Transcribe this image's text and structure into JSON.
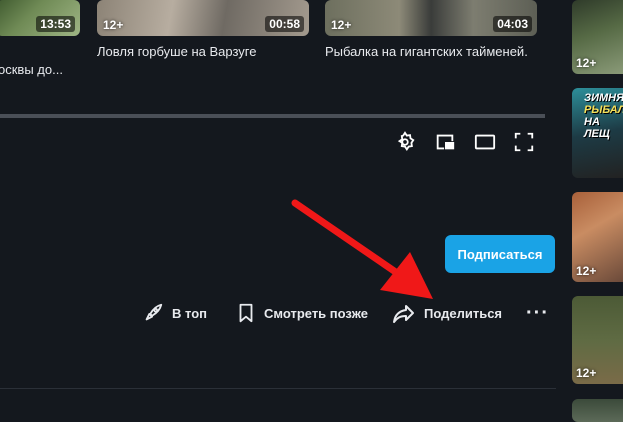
{
  "top_videos": [
    {
      "duration": "13:53",
      "title": "осквы до..."
    },
    {
      "age": "12+",
      "duration": "00:58",
      "title": "Ловля горбуше на Варзуге"
    },
    {
      "age": "12+",
      "duration": "04:03",
      "title": "Рыбалка на гигантских тайменей."
    }
  ],
  "side_videos": [
    {
      "age": "12+"
    },
    {
      "overlay_line1": "ЗИМНЯ",
      "overlay_line2": "РЫБАЛ",
      "overlay_line3": "НА ЛЕЩ"
    },
    {
      "age": "12+"
    },
    {
      "age": "12+"
    },
    {
      "age": ""
    }
  ],
  "player_controls": [
    "settings-icon",
    "miniplayer-icon",
    "theater-mode-icon",
    "fullscreen-icon"
  ],
  "subscribe_label": "Подписаться",
  "actions": {
    "top_label": "В топ",
    "watch_later_label": "Смотреть позже",
    "share_label": "Поделиться",
    "more_label": "···"
  },
  "colors": {
    "background": "#14181e",
    "accent": "#1aa3e6",
    "arrow": "#f01818"
  }
}
